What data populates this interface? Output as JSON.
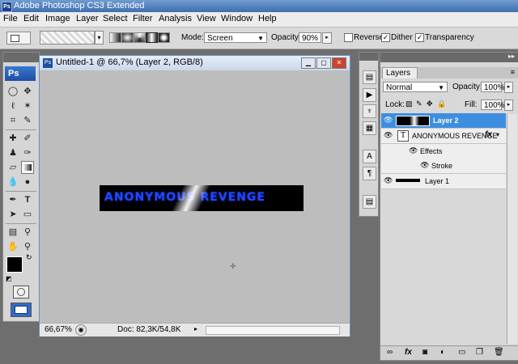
{
  "window": {
    "app_icon": "Ps",
    "title": "Adobe Photoshop CS3 Extended"
  },
  "menu": [
    "File",
    "Edit",
    "Image",
    "Layer",
    "Select",
    "Filter",
    "Analysis",
    "View",
    "Window",
    "Help"
  ],
  "options": {
    "mode_label": "Mode:",
    "mode_value": "Screen",
    "opacity_label": "Opacity:",
    "opacity_value": "90%",
    "reverse_label": "Reverse",
    "dither_label": "Dither",
    "transparency_label": "Transparency",
    "reverse_checked": false,
    "dither_checked": true,
    "transparency_checked": true
  },
  "toolbox": {
    "logo": "Ps"
  },
  "document": {
    "title": "Untitled-1 @ 66,7% (Layer 2, RGB/8)",
    "icon": "Ps",
    "banner_text": "ANONYMOUS REVENGE",
    "zoom": "66,67%",
    "doc_size": "Doc: 82,3K/54,8K"
  },
  "layers_panel": {
    "tab_label": "Layers",
    "blend_mode": "Normal",
    "opacity_label": "Opacity:",
    "opacity_value": "100%",
    "lock_label": "Lock:",
    "fill_label": "Fill:",
    "fill_value": "100%",
    "layers": [
      {
        "name": "Layer 2",
        "selected": true
      },
      {
        "name": "ANONYMOUS REVENGE",
        "selected": false
      },
      {
        "name": "Effects",
        "selected": false
      },
      {
        "name": "Stroke",
        "selected": false
      },
      {
        "name": "Layer 1",
        "selected": false
      }
    ],
    "fx_glyph": "fx"
  },
  "colors": {
    "accent": "#3d8ee0",
    "banner_text": "#2247ff",
    "foreground": "#000000",
    "background": "#1040e0"
  }
}
